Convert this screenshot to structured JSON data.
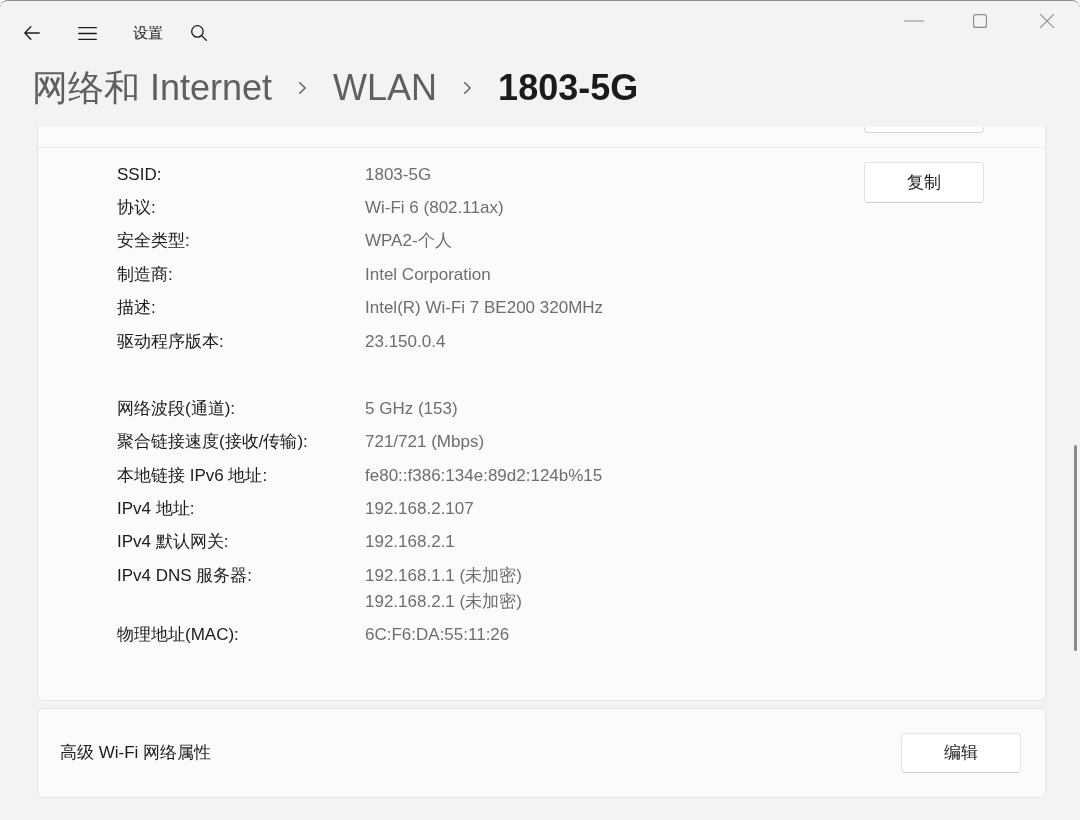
{
  "window": {
    "title": "设置"
  },
  "breadcrumb": [
    {
      "label": "网络和 Internet",
      "current": false
    },
    {
      "label": "WLAN",
      "current": false
    },
    {
      "label": "1803-5G",
      "current": true
    }
  ],
  "properties": {
    "copy_button": "复制",
    "groups": [
      [
        {
          "label": "SSID:",
          "values": [
            "1803-5G"
          ]
        },
        {
          "label": "协议:",
          "values": [
            "Wi-Fi 6 (802.11ax)"
          ]
        },
        {
          "label": "安全类型:",
          "values": [
            "WPA2-个人"
          ]
        },
        {
          "label": "制造商:",
          "values": [
            "Intel Corporation"
          ]
        },
        {
          "label": "描述:",
          "values": [
            "Intel(R) Wi-Fi 7 BE200 320MHz"
          ]
        },
        {
          "label": "驱动程序版本:",
          "values": [
            "23.150.0.4"
          ]
        }
      ],
      [
        {
          "label": "网络波段(通道):",
          "values": [
            "5 GHz (153)"
          ]
        },
        {
          "label": "聚合链接速度(接收/传输):",
          "values": [
            "721/721 (Mbps)"
          ]
        },
        {
          "label": "本地链接 IPv6 地址:",
          "values": [
            "fe80::f386:134e:89d2:124b%15"
          ]
        },
        {
          "label": "IPv4 地址:",
          "values": [
            "192.168.2.107"
          ]
        },
        {
          "label": "IPv4 默认网关:",
          "values": [
            "192.168.2.1"
          ]
        },
        {
          "label": "IPv4 DNS 服务器:",
          "values": [
            "192.168.1.1 (未加密)",
            "192.168.2.1 (未加密)"
          ]
        },
        {
          "label": "物理地址(MAC):",
          "values": [
            "6C:F6:DA:55:11:26"
          ]
        }
      ]
    ]
  },
  "advanced": {
    "label": "高级 Wi-Fi 网络属性",
    "button": "编辑"
  }
}
